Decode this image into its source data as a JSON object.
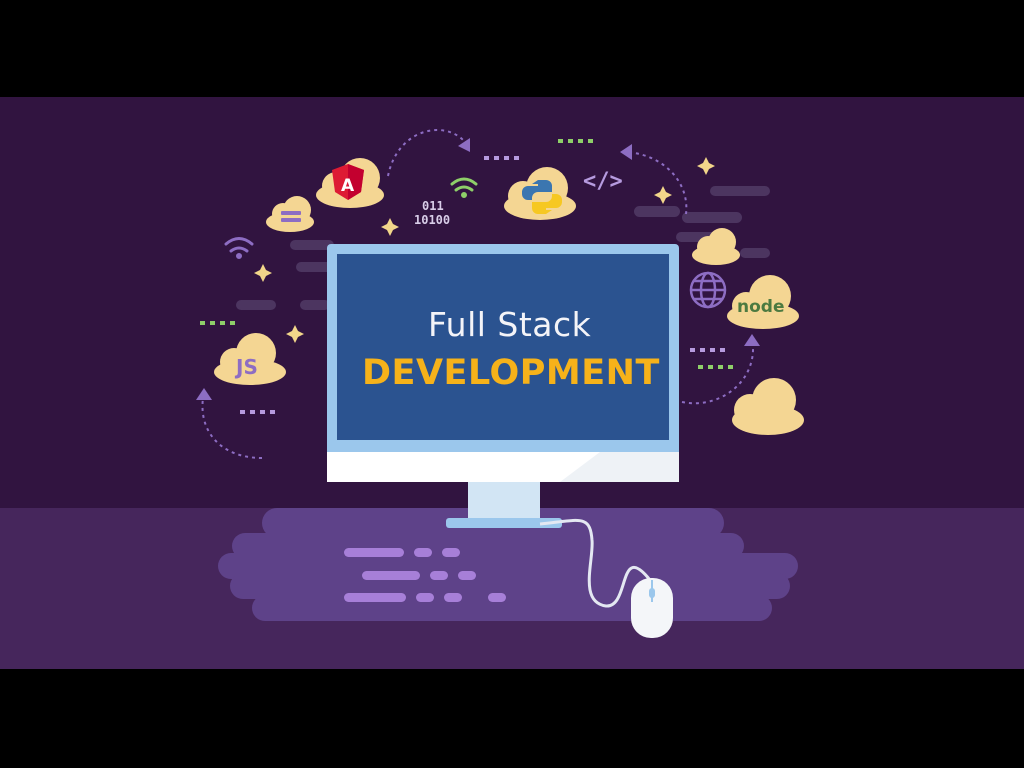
{
  "screen": {
    "title_line": "Full Stack",
    "subtitle_line": "DEVELOPMENT"
  },
  "clouds": {
    "angular_letter": "A",
    "js_label": "JS",
    "node_label": "node"
  },
  "code_tag": "</>",
  "binary": {
    "line1": "011",
    "line2": "10100"
  },
  "colors": {
    "background": "#311440",
    "floor": "#46265c",
    "platform": "#5e4289",
    "screen": "#2b5390",
    "screen_frame": "#9bc7ec",
    "cloud": "#f4d693",
    "accent_yellow": "#f6b21a",
    "accent_purple": "#8d6dc3",
    "angular_red": "#dd1b34"
  },
  "icons": [
    "angular-icon",
    "python-icon",
    "js-icon",
    "node-icon",
    "globe-icon",
    "wifi-icon",
    "code-tag-icon",
    "sparkle-icon",
    "mouse-icon",
    "monitor-icon"
  ]
}
